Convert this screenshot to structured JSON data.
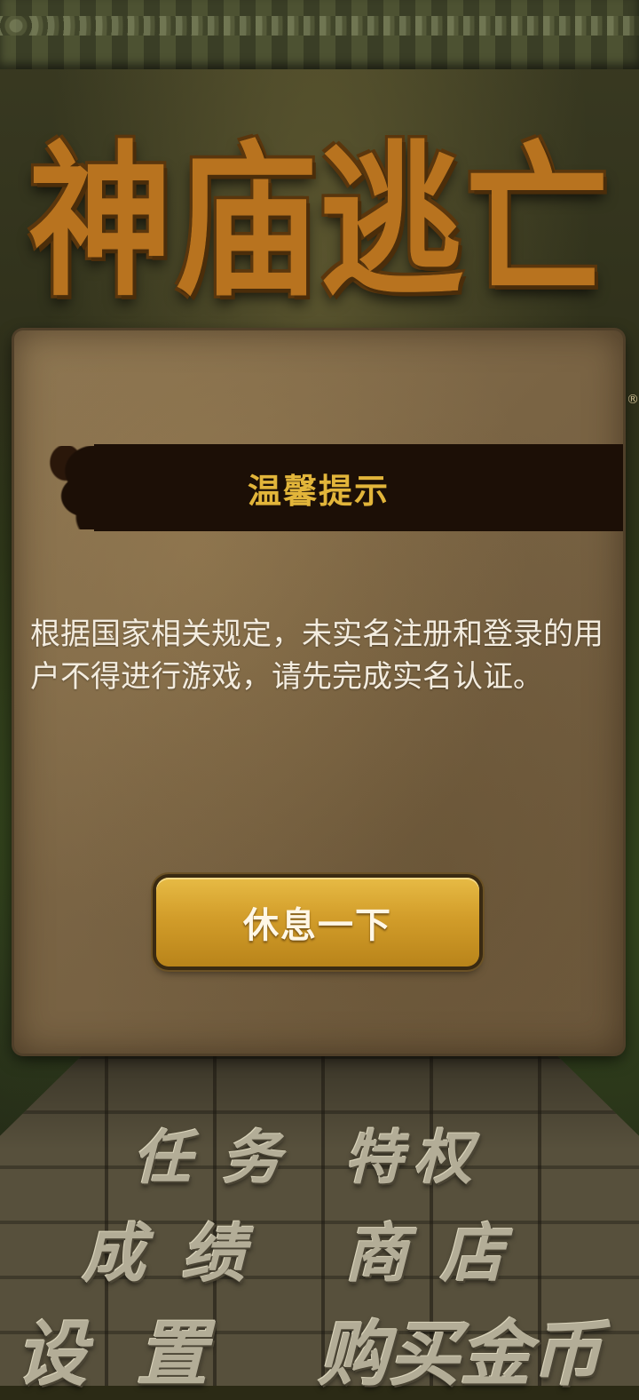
{
  "game": {
    "logo_text": "神庙逃亡",
    "registered_mark": "®"
  },
  "menu": {
    "quests": "任务",
    "privilege": "特权",
    "scores": "成绩",
    "store": "商店",
    "settings": "设置",
    "buy_coins": "购买金币"
  },
  "dialog": {
    "title": "温馨提示",
    "message": "根据国家相关规定，未实名注册和登录的用户不得进行游戏，请先完成实名认证。",
    "button_label": "休息一下"
  },
  "colors": {
    "title_text": "#e2b53a",
    "title_bar": "#1c0f06",
    "button": "#d29d2a",
    "logo": "#b8731f"
  }
}
